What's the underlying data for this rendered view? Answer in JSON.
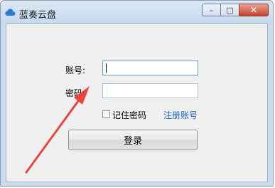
{
  "window": {
    "title": "蓝奏云盘",
    "controls": {
      "minimize": "–",
      "maximize": "□",
      "close": "✕"
    }
  },
  "form": {
    "account_label": "账号:",
    "account_value": "",
    "password_label": "密码:",
    "password_value": "",
    "remember_label": "记住密码",
    "remember_checked": false,
    "register_link": "注册账号",
    "login_button": "登录"
  },
  "colors": {
    "link": "#1e66c8",
    "arrow": "#e8453c",
    "title_bar": "#c9dcef"
  },
  "icons": {
    "app": "cloud-icon",
    "annotation": "red-arrow"
  }
}
